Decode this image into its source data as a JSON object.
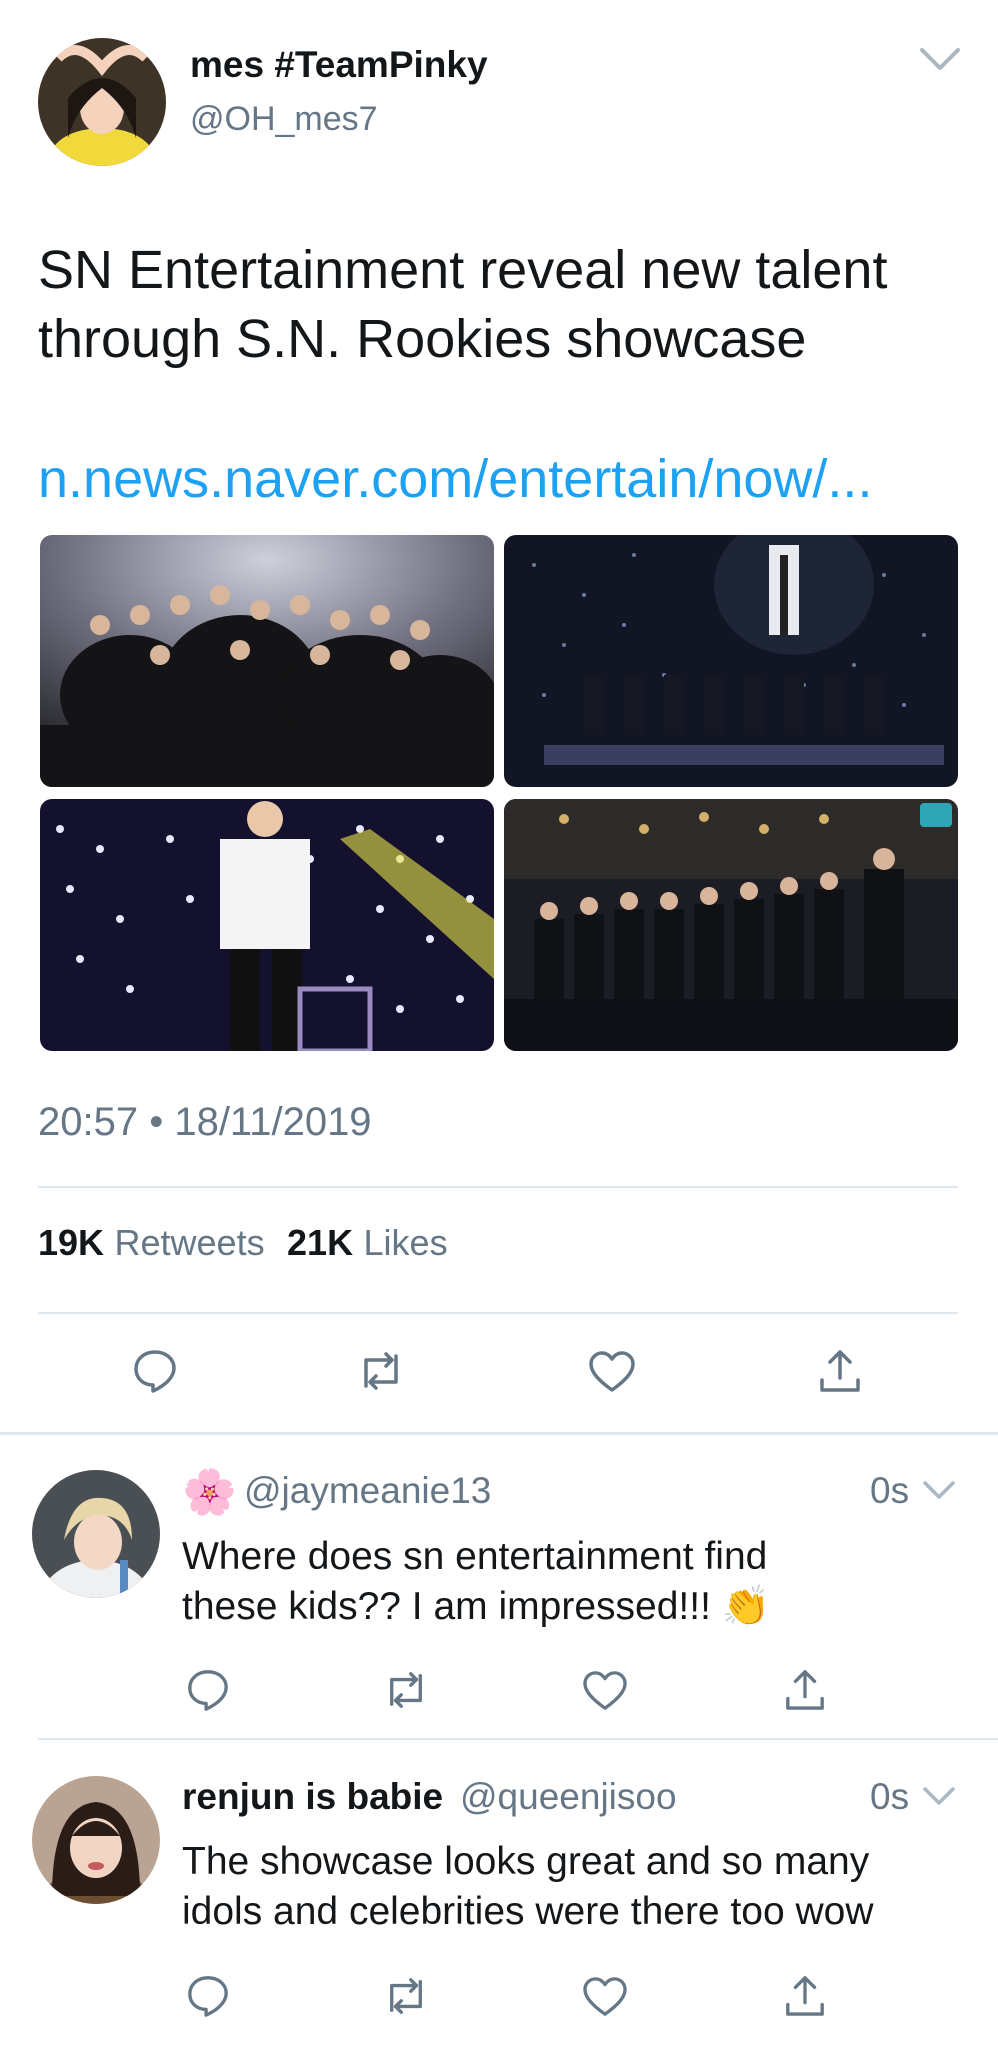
{
  "main_tweet": {
    "display_name": "mes #TeamPinky",
    "handle": "@OH_mes7",
    "text_line1": "SN Entertainment reveal new talent",
    "text_line2": "through S.N. Rookies showcase",
    "link": "n.news.naver.com/entertain/now/...",
    "timestamp": "20:57 • 18/11/2019",
    "retweets_count": "19K",
    "retweets_label": "Retweets",
    "likes_count": "21K",
    "likes_label": "Likes",
    "icons": [
      "chevron-down-icon",
      "reply-icon",
      "retweet-icon",
      "like-icon",
      "share-icon"
    ]
  },
  "replies": [
    {
      "emoji": "🌸",
      "display_name": "",
      "handle": "@jaymeanie13",
      "time": "0s",
      "text_line1": "Where does sn entertainment find",
      "text_line2": "these kids?? I am impressed!!! 👏"
    },
    {
      "display_name": "renjun is babie",
      "handle": "@queenjisoo",
      "time": "0s",
      "text_line1": "The showcase looks great and so many",
      "text_line2": "idols and celebrities were there too wow"
    }
  ],
  "colors": {
    "link": "#1da1f2",
    "secondary": "#657786",
    "divider": "#e1e8ed",
    "icon": "#657786"
  }
}
